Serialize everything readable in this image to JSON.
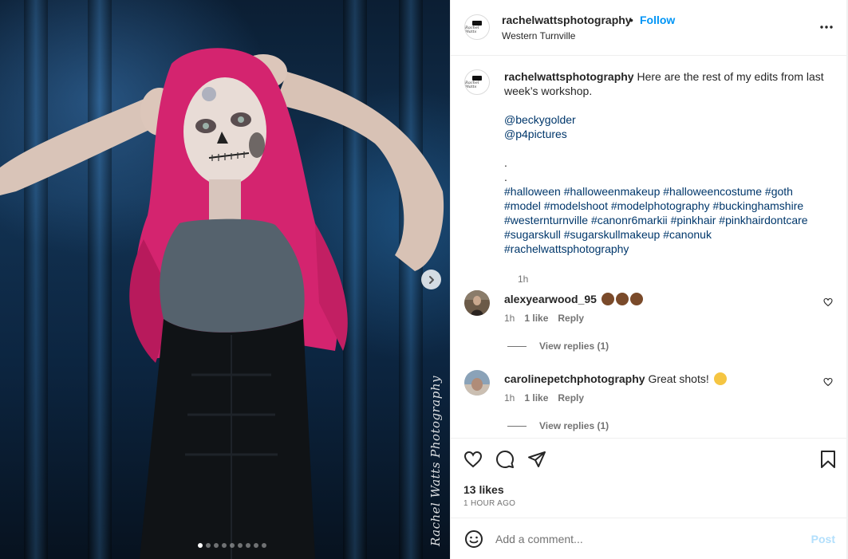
{
  "post": {
    "username": "rachelwattsphotography",
    "separator": "•",
    "follow_label": "Follow",
    "location": "Western Turnville",
    "watermark_text": "Rachel Watts Photography",
    "carousel_dot_count": 9,
    "carousel_active_index": 0
  },
  "caption": {
    "username": "rachelwattsphotography",
    "text": "Here are the rest of my edits from last week’s workshop.",
    "mentions": [
      "@beckygolder",
      "@p4pictures"
    ],
    "dot1": ".",
    "dot2": ".",
    "hashtags": [
      "#halloween",
      "#halloweenmakeup",
      "#halloweencostume",
      "#goth",
      "#model",
      "#modelshoot",
      "#modelphotography",
      "#buckinghamshire",
      "#westernturnville",
      "#canonr6markii",
      "#pinkhair",
      "#pinkhairdontcare",
      "#sugarskull",
      "#sugarskullmakeup",
      "#canonuk",
      "#rachelwattsphotography"
    ],
    "time": "1h"
  },
  "comments": [
    {
      "username": "alexyearwood_95",
      "text": "",
      "emoji": "clapping-hands-dark x3",
      "time": "1h",
      "likes": "1 like",
      "reply_label": "Reply",
      "view_replies": "View replies (1)"
    },
    {
      "username": "carolinepetchphotography",
      "text": "Great shots!",
      "emoji": "clapping-hands",
      "time": "1h",
      "likes": "1 like",
      "reply_label": "Reply",
      "view_replies": "View replies (1)"
    }
  ],
  "actions": {
    "likes": "13 likes",
    "time_ago": "1 HOUR AGO"
  },
  "add_comment": {
    "placeholder": "Add a comment...",
    "post_label": "Post"
  }
}
